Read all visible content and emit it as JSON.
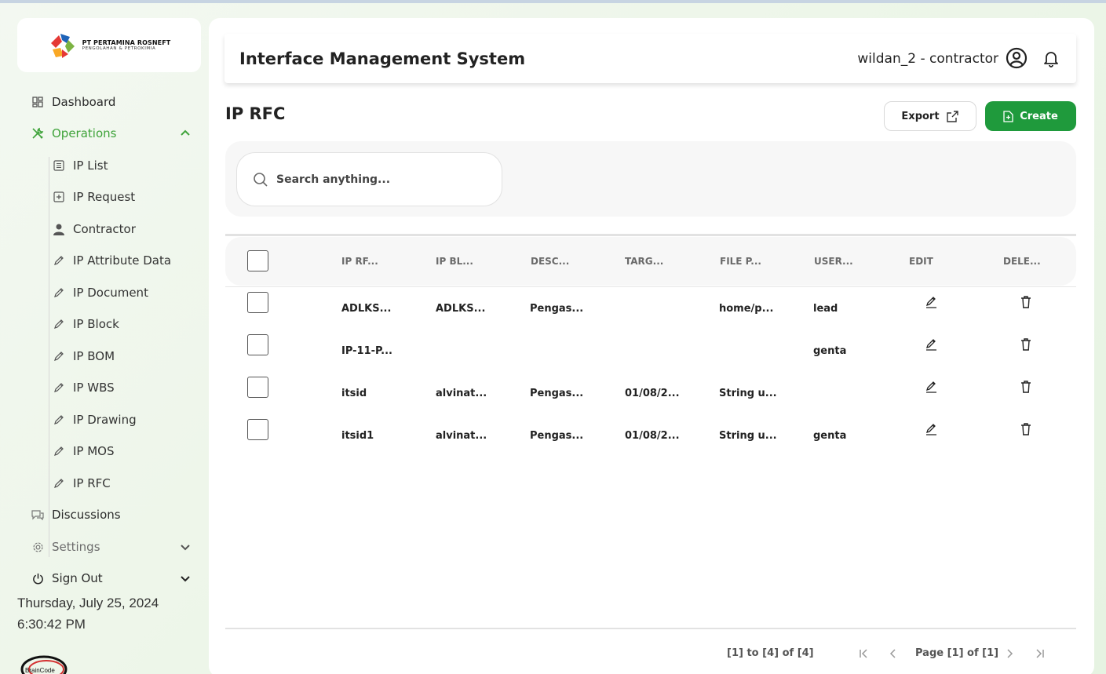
{
  "company": {
    "name_line1": "PT PERTAMINA ROSNEFT",
    "name_line2": "PENGOLAHAN & PETROKIMIA"
  },
  "sidebar": {
    "items": [
      {
        "label": "Dashboard",
        "icon": "dashboard-icon"
      },
      {
        "label": "Operations",
        "icon": "tools-icon",
        "expanded": true
      },
      {
        "label": "Discussions",
        "icon": "chat-icon"
      },
      {
        "label": "Settings",
        "icon": "gear-icon"
      },
      {
        "label": "Sign Out",
        "icon": "power-icon"
      }
    ],
    "sub_items": [
      {
        "label": "IP List",
        "icon": "list-icon"
      },
      {
        "label": "IP Request",
        "icon": "plus-square-icon"
      },
      {
        "label": "Contractor",
        "icon": "user-icon"
      },
      {
        "label": "IP Attribute Data",
        "icon": "pen-icon"
      },
      {
        "label": "IP Document",
        "icon": "pen-icon"
      },
      {
        "label": "IP Block",
        "icon": "pen-icon"
      },
      {
        "label": "IP BOM",
        "icon": "pen-icon"
      },
      {
        "label": "IP WBS",
        "icon": "pen-icon"
      },
      {
        "label": "IP Drawing",
        "icon": "pen-icon"
      },
      {
        "label": "IP MOS",
        "icon": "pen-icon"
      },
      {
        "label": "IP RFC",
        "icon": "pen-icon"
      }
    ],
    "date": "Thursday, July 25, 2024",
    "time": "6:30:42 PM",
    "footer_logo_text": "BrainCode"
  },
  "header": {
    "title": "Interface Management System",
    "user": "wildan_2 - contractor"
  },
  "page": {
    "title": "IP RFC",
    "export_label": "Export",
    "create_label": "Create",
    "search_placeholder": "Search anything..."
  },
  "table": {
    "columns": [
      "IP RF...",
      "IP BL...",
      "DESC...",
      "TARG...",
      "FILE P...",
      "USER...",
      "EDIT",
      "DELE..."
    ],
    "rows": [
      [
        "ADLKS...",
        "ADLKS...",
        "Pengas...",
        "",
        "home/p...",
        "lead"
      ],
      [
        "IP-11-P...",
        "",
        "",
        "",
        "",
        "genta"
      ],
      [
        "itsid",
        "alvinat...",
        "Pengas...",
        "01/08/2...",
        "String u...",
        ""
      ],
      [
        "itsid1",
        "alvinat...",
        "Pengas...",
        "01/08/2...",
        "String u...",
        "genta"
      ]
    ]
  },
  "pagination": {
    "range": "[1] to [4] of [4]",
    "page_label": "Page [1] of [1]"
  },
  "colors": {
    "accent": "#3fa33a",
    "create_button": "#1f9a3c"
  }
}
